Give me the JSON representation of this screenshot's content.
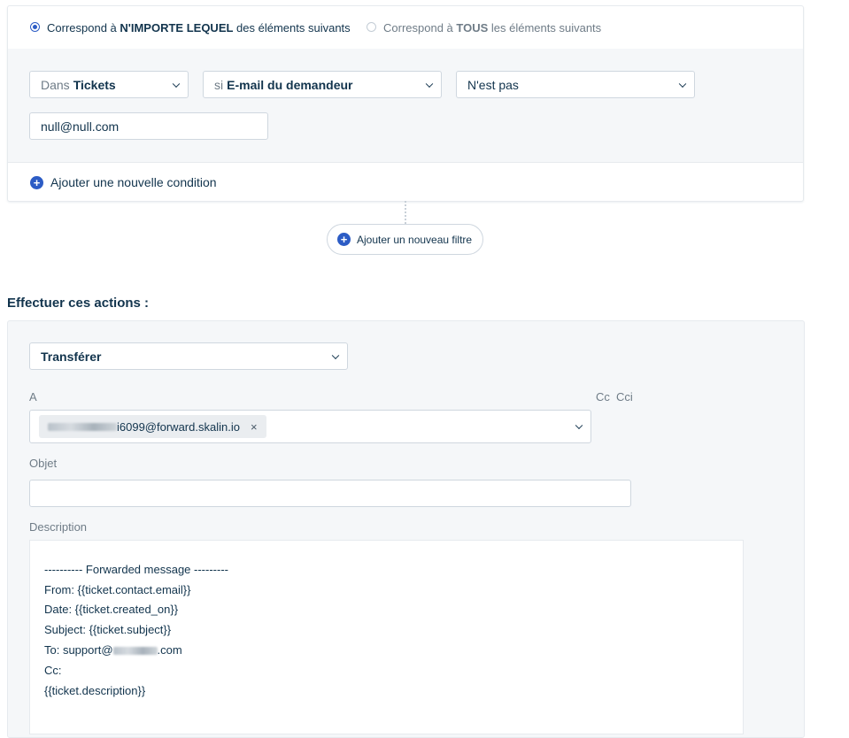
{
  "match": {
    "any_prefix": "Correspond à ",
    "any_bold": "N'IMPORTE LEQUEL",
    "any_suffix": " des éléments suivants",
    "all_prefix": "Correspond à ",
    "all_bold": "TOUS",
    "all_suffix": " les éléments suivants",
    "selected": "any"
  },
  "condition": {
    "scope_prefix": "Dans",
    "scope_value": "Tickets",
    "field_prefix": "si",
    "field_value": "E-mail du demandeur",
    "operator": "N'est pas",
    "value": "null@null.com"
  },
  "add_condition_label": "Ajouter une nouvelle condition",
  "add_filter_label": "Ajouter un nouveau filtre",
  "actions": {
    "title": "Effectuer ces actions :",
    "action_type": "Transférer",
    "to_label": "A",
    "cc_label": "Cc",
    "bcc_label": "Cci",
    "recipient_visible_suffix": "i6099@forward.skalin.io",
    "subject_label": "Objet",
    "subject_value": "",
    "description_label": "Description",
    "description_lines": {
      "l1": "---------- Forwarded message ---------",
      "l2": "From: {{ticket.contact.email}}",
      "l3": "Date: {{ticket.created_on}}",
      "l4": "Subject: {{ticket.subject}}",
      "l5_prefix": "To: support@",
      "l5_suffix": ".com",
      "l6": "Cc:",
      "l7": "{{ticket.description}}"
    }
  },
  "colors": {
    "accent": "#2c5cc5",
    "text": "#12344d",
    "muted": "#6f7c87",
    "panel": "#f5f7f9",
    "border": "#cfd7df"
  }
}
